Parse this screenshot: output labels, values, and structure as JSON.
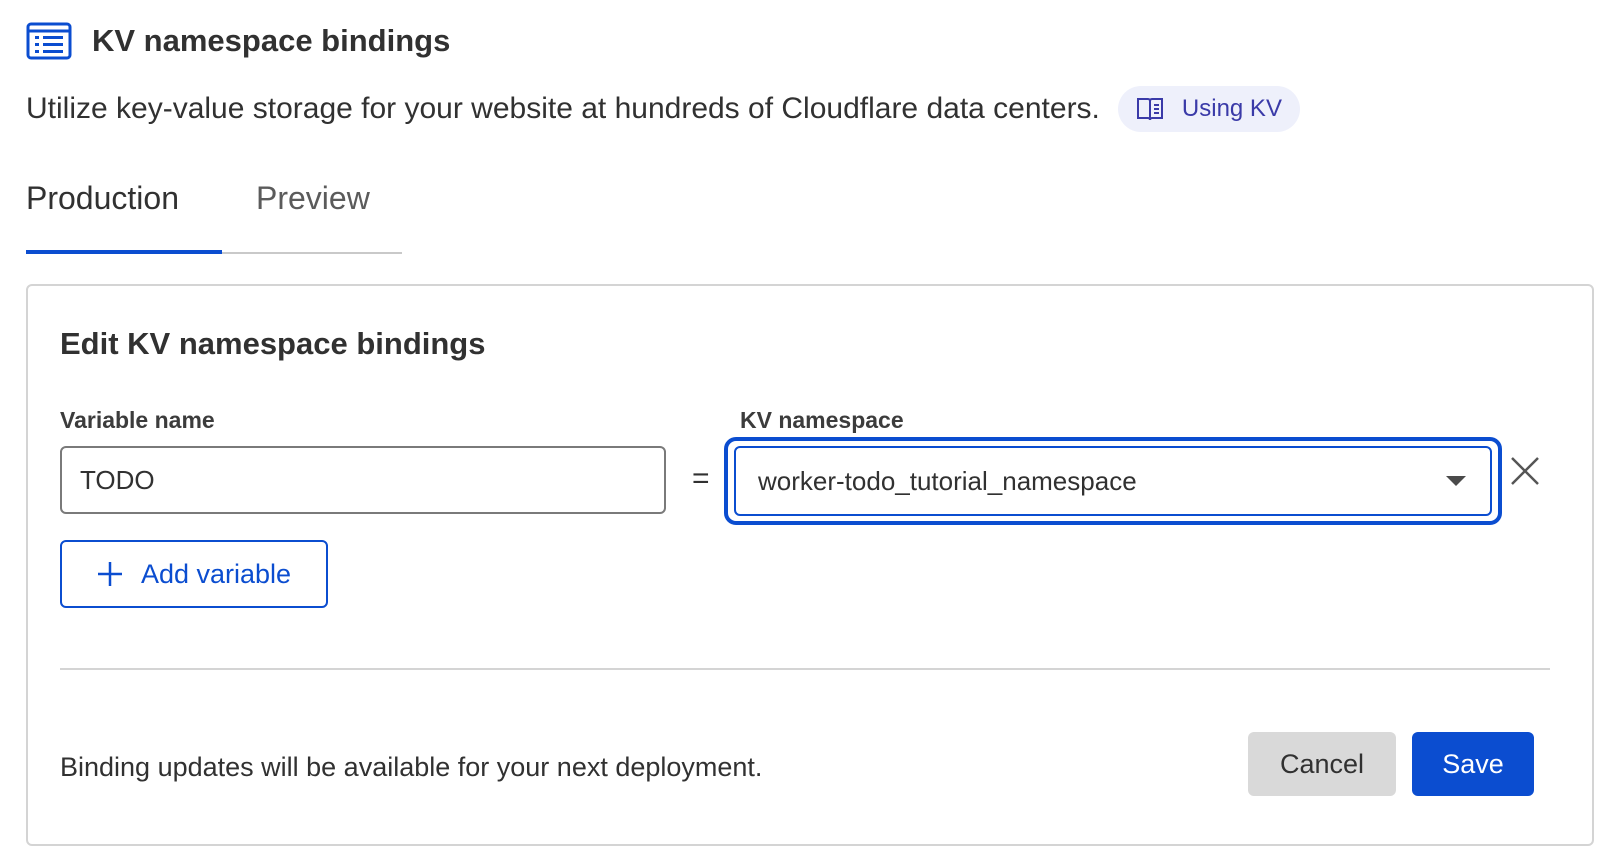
{
  "header": {
    "icon": "list-icon",
    "title": "KV namespace bindings",
    "subtitle": "Utilize key-value storage for your website at hundreds of Cloudflare data centers.",
    "doc_link": {
      "icon": "book-icon",
      "label": "Using KV"
    }
  },
  "tabs": [
    {
      "label": "Production",
      "active": true
    },
    {
      "label": "Preview",
      "active": false
    }
  ],
  "editor": {
    "title": "Edit KV namespace bindings",
    "variable_label": "Variable name",
    "variable_value": "TODO",
    "equals": "=",
    "namespace_label": "KV namespace",
    "namespace_value": "worker-todo_tutorial_namespace",
    "add_label": "Add variable",
    "footer_note": "Binding updates will be available for your next deployment.",
    "cancel_label": "Cancel",
    "save_label": "Save"
  },
  "colors": {
    "accent": "#0b4dd0",
    "text": "#313131",
    "pill_bg": "#eef0fb",
    "cancel_bg": "#d9d9d9"
  }
}
